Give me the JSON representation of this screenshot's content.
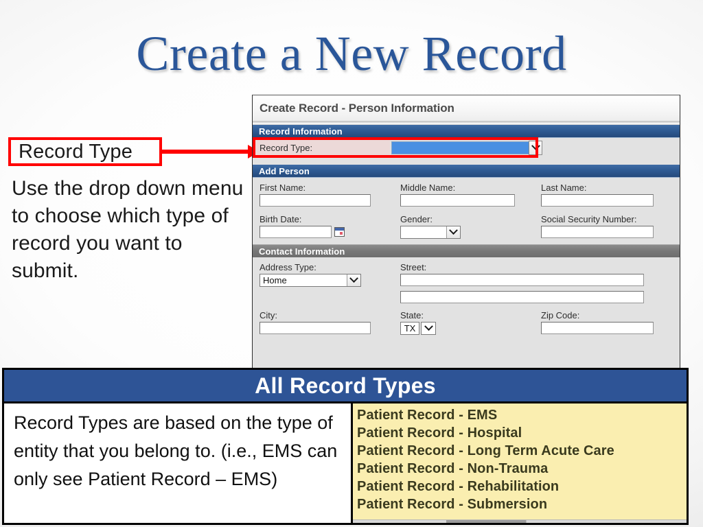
{
  "slide": {
    "title": "Create a New Record",
    "title_color": "#2a5699"
  },
  "annotation": {
    "callout_label": "Record Type",
    "callout_border_color": "#ff0000",
    "body_text": "Use the drop down menu to choose which type of record you want to submit."
  },
  "form": {
    "window_title": "Create Record - Person Information",
    "sections": {
      "record_information": {
        "header": "Record Information",
        "header_color": "#2f5b93",
        "record_type_label": "Record Type:",
        "record_type_value": "",
        "record_type_highlight_color": "#4a90e2",
        "chevron_icon": "chevron-down-icon"
      },
      "add_person": {
        "header": "Add Person",
        "header_color": "#2f5b93",
        "first_name_label": "First Name:",
        "first_name_value": "",
        "middle_name_label": "Middle Name:",
        "middle_name_value": "",
        "last_name_label": "Last Name:",
        "last_name_value": "",
        "birth_date_label": "Birth Date:",
        "birth_date_value": "",
        "calendar_icon": "calendar-icon",
        "gender_label": "Gender:",
        "gender_value": "",
        "ssn_label": "Social Security Number:",
        "ssn_value": ""
      },
      "contact_information": {
        "header": "Contact Information",
        "header_color": "#777777",
        "address_type_label": "Address Type:",
        "address_type_value": "Home",
        "street_label": "Street:",
        "street_line1_value": "",
        "street_line2_value": "",
        "city_label": "City:",
        "city_value": "",
        "state_label": "State:",
        "state_value": "TX",
        "zip_label": "Zip Code:",
        "zip_value": ""
      }
    }
  },
  "bottom_panel": {
    "banner_title": "All Record Types",
    "banner_color": "#2e5496",
    "description": "Record Types are based on the type of entity that you belong to. (i.e., EMS can only see Patient Record – EMS)",
    "list_background_color": "#faeeb0",
    "record_types": [
      "Patient Record - EMS",
      "Patient Record - Hospital",
      "Patient Record - Long Term Acute Care",
      "Patient Record - Non-Trauma",
      "Patient Record - Rehabilitation",
      "Patient Record - Submersion"
    ]
  }
}
